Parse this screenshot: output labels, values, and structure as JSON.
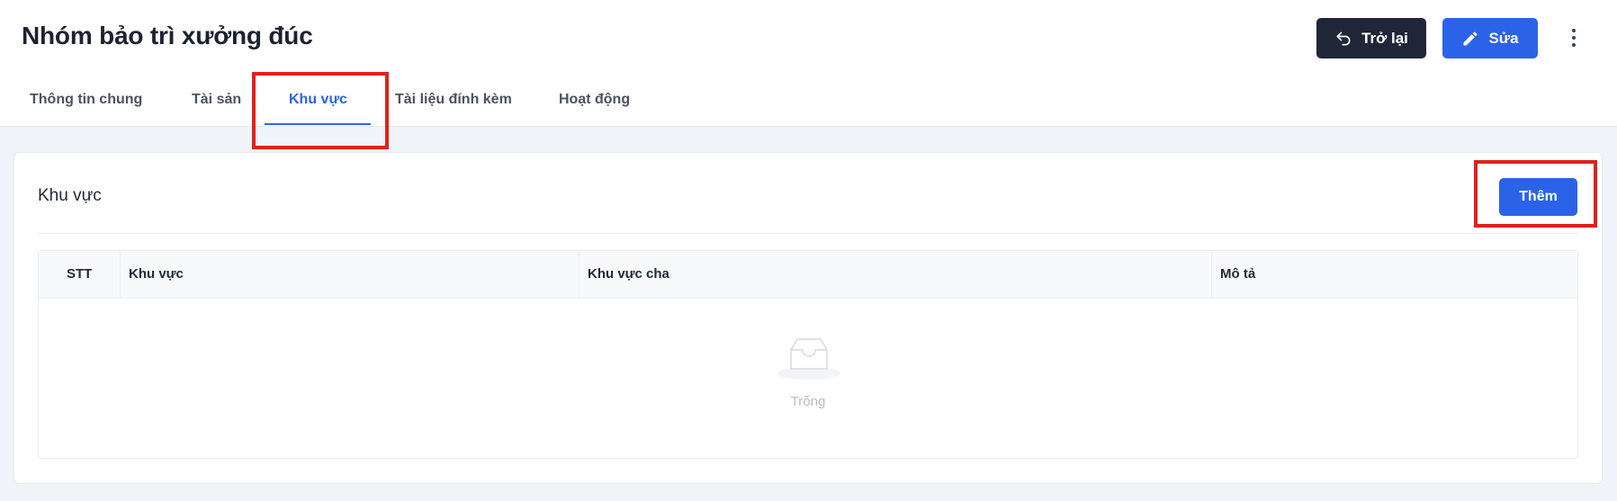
{
  "header": {
    "title": "Nhóm bảo trì xưởng đúc",
    "back_label": "Trở lại",
    "edit_label": "Sửa"
  },
  "tabs": [
    {
      "label": "Thông tin chung",
      "active": false
    },
    {
      "label": "Tài sản",
      "active": false
    },
    {
      "label": "Khu vực",
      "active": true
    },
    {
      "label": "Tài liệu đính kèm",
      "active": false
    },
    {
      "label": "Hoạt động",
      "active": false
    }
  ],
  "section": {
    "title": "Khu vực",
    "add_label": "Thêm"
  },
  "table": {
    "columns": [
      "STT",
      "Khu vực",
      "Khu vực cha",
      "Mô tả"
    ],
    "rows": [],
    "empty_text": "Trống"
  },
  "colors": {
    "accent": "#2b63e8",
    "dark_button": "#1e2638",
    "highlight": "#e0211d"
  },
  "icons": [
    "undo-arrow-icon",
    "pencil-icon",
    "more-vertical-icon",
    "empty-inbox-icon"
  ]
}
